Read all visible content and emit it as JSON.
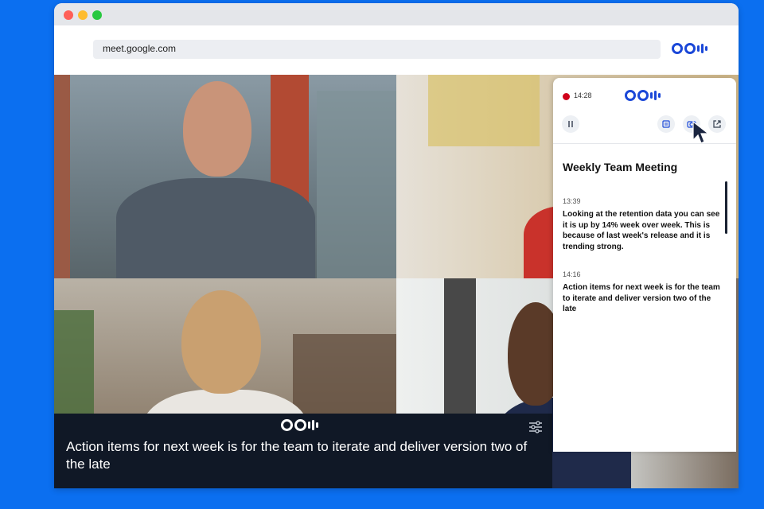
{
  "browser": {
    "url": "meet.google.com"
  },
  "caption": {
    "text": "Action items for next week is for the team to iterate and deliver version two of the late"
  },
  "panel": {
    "recording_time": "14:28",
    "meeting_title": "Weekly Team Meeting",
    "transcript": [
      {
        "time": "13:39",
        "text": "Looking at the retention data you can see it is up by 14% week over week. This is because of last week's release and it is trending strong."
      },
      {
        "time": "14:16",
        "text": "Action items for next week is for the team to iterate and deliver version two of the late"
      }
    ]
  },
  "icons": {
    "logo": "otter-logo-icon",
    "pause": "pause-icon",
    "notes": "notes-icon",
    "camera": "camera-icon",
    "popout": "external-link-icon",
    "settings": "settings-sliders-icon",
    "cursor": "mouse-cursor-icon"
  },
  "colors": {
    "background": "#0b6ff0",
    "brand": "#1b48d8",
    "recording": "#d0021b",
    "caption_bg": "#101826"
  }
}
